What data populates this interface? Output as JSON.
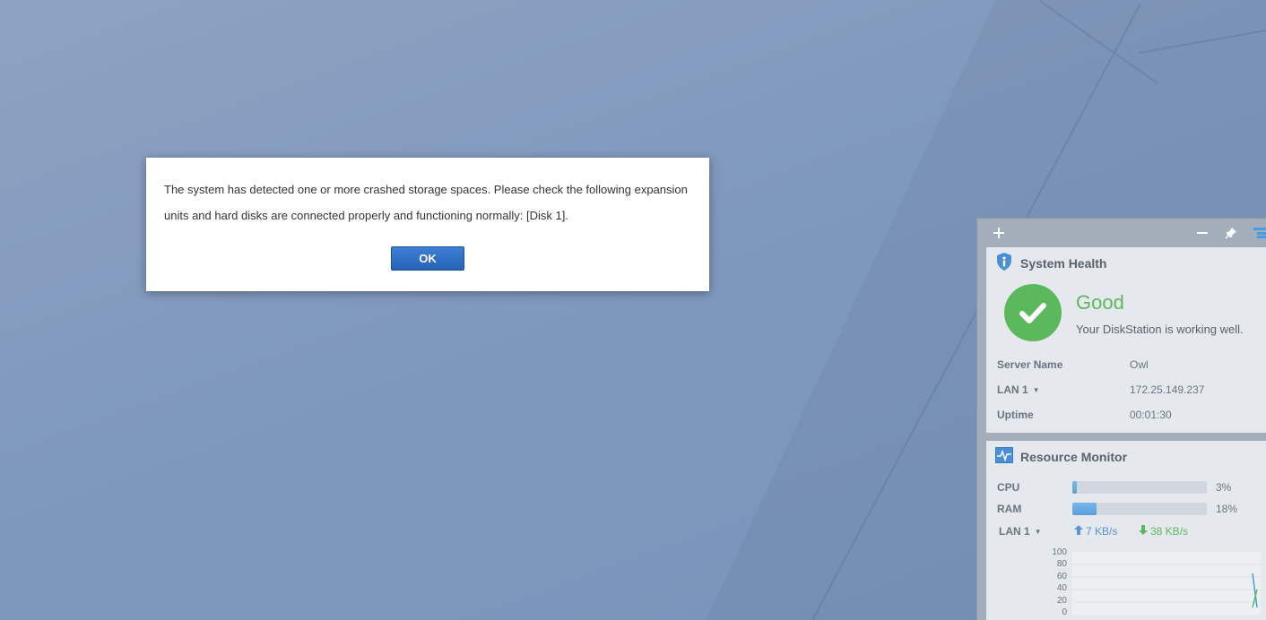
{
  "dialog": {
    "message": "The system has detected one or more crashed storage spaces. Please check the following expansion units and hard disks are connected properly and functioning normally: [Disk 1].",
    "ok_label": "OK"
  },
  "widget_toolbar": {
    "add_icon": "plus-icon",
    "minimize_icon": "minus-icon",
    "pin_icon": "pin-icon",
    "layout_icon": "layout-icon"
  },
  "system_health": {
    "title": "System Health",
    "status": "Good",
    "description": "Your DiskStation is working well.",
    "fields": [
      {
        "label": "Server Name",
        "value": "Owl"
      },
      {
        "label": "LAN 1",
        "value": "172.25.149.237"
      },
      {
        "label": "Uptime",
        "value": "00:01:30"
      }
    ],
    "colors": {
      "good": "#5cb85c"
    }
  },
  "resource_monitor": {
    "title": "Resource Monitor",
    "cpu": {
      "label": "CPU",
      "percent_text": "3%",
      "fraction": 0.03
    },
    "ram": {
      "label": "RAM",
      "percent_text": "18%",
      "fraction": 0.18
    },
    "lan": {
      "label": "LAN 1",
      "upload": "7 KB/s",
      "download": "38 KB/s"
    },
    "chart_ticks": [
      "100",
      "80",
      "60",
      "40",
      "20",
      "0"
    ]
  }
}
